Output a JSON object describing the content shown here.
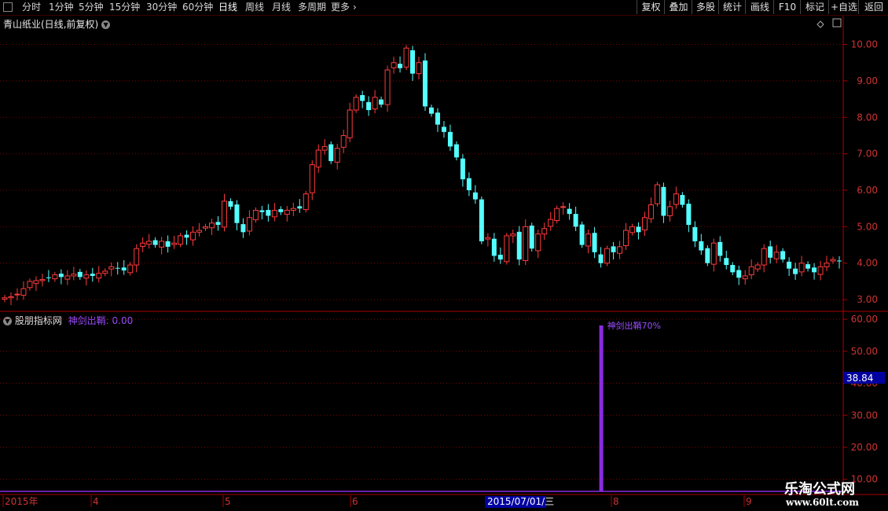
{
  "toolbar": {
    "periods": [
      "分时",
      "1分钟",
      "5分钟",
      "15分钟",
      "30分钟",
      "60分钟",
      "日线",
      "周线",
      "月线",
      "多周期",
      "更多"
    ],
    "active": "日线",
    "right": [
      "复权",
      "叠加",
      "多股",
      "统计",
      "画线",
      "F10",
      "标记",
      "+自选",
      "返回"
    ]
  },
  "stock_title": "青山纸业(日线,前复权)",
  "indicator": {
    "panel_name": "股朋指标网",
    "series_label": "神剑出鞘: 0.00",
    "peak_label": "神剑出鞘70%",
    "cursor_value": "38.84"
  },
  "time_axis": {
    "labels": [
      "2015年",
      "4",
      "5",
      "6",
      "8",
      "9"
    ],
    "cursor_date": "2015/07/01/三"
  },
  "watermark": {
    "line1": "乐淘公式网",
    "line2": "www.60lt.com"
  },
  "colors": {
    "up": "#ff3b3b",
    "down": "#54ffff",
    "grid": "#7a0000",
    "axis": "#aa0000",
    "indicator": "#8a2be2",
    "cursor_bg": "#0000a0"
  },
  "chart_data": [
    {
      "type": "candlestick",
      "title": "青山纸业(日线,前复权)",
      "ylim": [
        2.7,
        10.4
      ],
      "y_ticks": [
        3.0,
        4.0,
        5.0,
        6.0,
        7.0,
        8.0,
        9.0,
        10.0
      ],
      "y_tick_labels": [
        "3.00",
        "4.00",
        "5.00",
        "6.00",
        "7.00",
        "8.00",
        "9.00",
        "10.00"
      ],
      "x_tick_labels": [
        "2015年",
        "4",
        "5",
        "6",
        "8",
        "9"
      ],
      "closes": [
        3.05,
        3.08,
        3.15,
        3.3,
        3.5,
        3.52,
        3.55,
        3.6,
        3.68,
        3.62,
        3.65,
        3.7,
        3.62,
        3.68,
        3.65,
        3.72,
        3.78,
        3.9,
        3.85,
        3.8,
        3.95,
        4.4,
        4.55,
        4.6,
        4.5,
        4.6,
        4.45,
        4.55,
        4.75,
        4.7,
        4.85,
        4.9,
        5.0,
        5.1,
        5.05,
        5.7,
        5.55,
        5.1,
        4.85,
        5.25,
        5.45,
        5.4,
        5.3,
        5.45,
        5.4,
        5.45,
        5.5,
        5.5,
        5.9,
        6.7,
        7.1,
        7.2,
        6.8,
        7.15,
        7.5,
        8.2,
        8.55,
        8.45,
        8.2,
        8.55,
        8.35,
        9.3,
        9.5,
        9.35,
        9.9,
        9.2,
        9.5,
        8.3,
        8.1,
        7.8,
        7.6,
        7.2,
        6.9,
        6.3,
        6.0,
        5.75,
        4.6,
        4.7,
        4.2,
        4.1,
        4.75,
        4.8,
        4.1,
        5.0,
        4.4,
        4.8,
        4.95,
        5.2,
        5.5,
        5.55,
        5.35,
        5.0,
        4.5,
        4.8,
        4.3,
        4.0,
        4.4,
        4.3,
        4.45,
        4.9,
        5.0,
        4.85,
        5.25,
        5.6,
        6.15,
        5.3,
        5.55,
        5.9,
        5.6,
        5.05,
        4.6,
        4.35,
        4.0,
        4.55,
        4.2,
        3.95,
        3.75,
        3.6,
        3.65,
        3.9,
        3.95,
        4.4,
        4.15,
        4.3,
        4.1,
        3.85,
        3.7,
        4.0,
        3.85,
        3.75,
        3.9,
        4.0,
        4.1,
        4.05
      ],
      "last_close": 4.05
    },
    {
      "type": "bar",
      "name": "神剑出鞘",
      "ylim": [
        6.0,
        62.0
      ],
      "y_ticks": [
        10,
        20,
        30,
        40,
        50,
        60
      ],
      "y_tick_labels": [
        "10.00",
        "20.00",
        "30.00",
        "40.00",
        "50.00",
        "60.00"
      ],
      "peak_value": 70,
      "peak_bar_index": 95,
      "current_value": 0.0
    }
  ]
}
